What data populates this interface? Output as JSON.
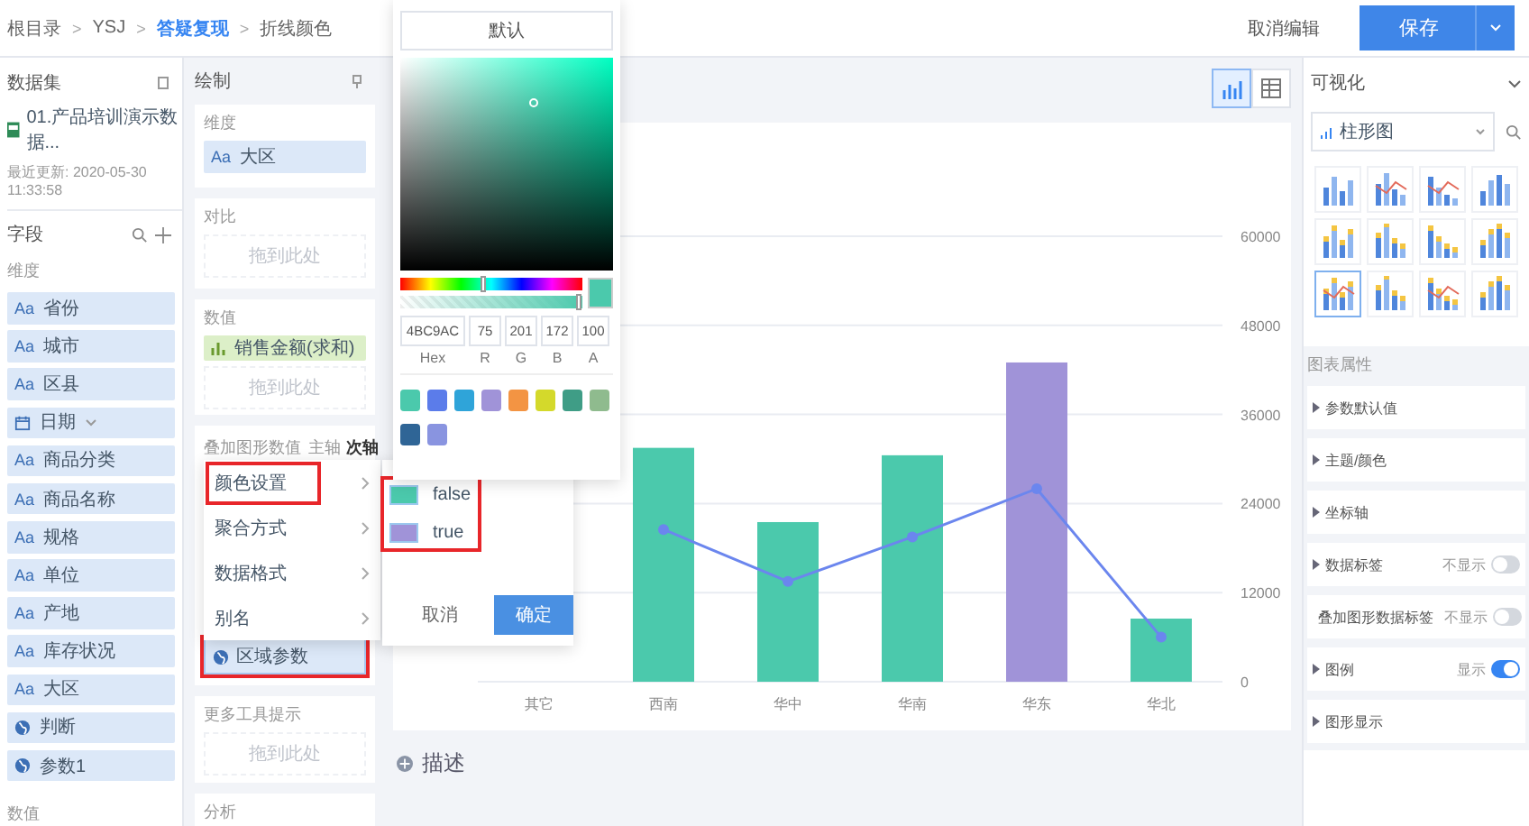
{
  "top_bar": {
    "breadcrumb": [
      {
        "label": "根目录",
        "link": false
      },
      {
        "label": "YSJ",
        "link": false
      },
      {
        "label": "答疑复现",
        "link": true
      },
      {
        "label": "折线颜色",
        "link": false
      }
    ],
    "separator": ">",
    "cancel": "取消编辑",
    "save": "保存"
  },
  "dataset_panel": {
    "title": "数据集",
    "dataset": "01.产品培训演示数据...",
    "updated": "最近更新: 2020-05-30 11:33:58",
    "fields_title": "字段",
    "dimension_label": "维度",
    "fields": [
      {
        "kind": "text",
        "prefix": "Aa",
        "label": "省份"
      },
      {
        "kind": "text",
        "prefix": "Aa",
        "label": "城市"
      },
      {
        "kind": "text",
        "prefix": "Aa",
        "label": "区县"
      },
      {
        "kind": "date",
        "label": "日期"
      },
      {
        "kind": "text",
        "prefix": "Aa",
        "label": "商品分类"
      },
      {
        "kind": "text",
        "prefix": "Aa",
        "label": "商品名称"
      },
      {
        "kind": "text",
        "prefix": "Aa",
        "label": "规格"
      },
      {
        "kind": "text",
        "prefix": "Aa",
        "label": "单位"
      },
      {
        "kind": "text",
        "prefix": "Aa",
        "label": "产地"
      },
      {
        "kind": "text",
        "prefix": "Aa",
        "label": "库存状况"
      },
      {
        "kind": "text",
        "prefix": "Aa",
        "label": "大区"
      },
      {
        "kind": "param",
        "label": "判断"
      },
      {
        "kind": "param",
        "label": "参数1"
      }
    ],
    "measure_label": "数值"
  },
  "draw_panel": {
    "title": "绘制",
    "dimension": {
      "label": "维度",
      "item_prefix": "Aa",
      "item": "大区"
    },
    "compare": {
      "label": "对比",
      "placeholder": "拖到此处"
    },
    "value": {
      "label": "数值",
      "item": "销售金额(求和)",
      "placeholder": "拖到此处"
    },
    "overlay": {
      "label": "叠加图形数值",
      "axes": [
        {
          "label": "主轴",
          "selected": false
        },
        {
          "label": "次轴",
          "selected": true
        }
      ]
    },
    "region_param": {
      "label": "区域参数",
      "highlighted": true
    },
    "tooltip": {
      "label": "更多工具提示",
      "placeholder": "拖到此处"
    },
    "analysis": {
      "label": "分析"
    }
  },
  "context_menu": [
    {
      "label": "颜色设置",
      "highlighted": true
    },
    {
      "label": "聚合方式",
      "highlighted": false
    },
    {
      "label": "数据格式",
      "highlighted": false
    },
    {
      "label": "别名",
      "highlighted": false
    }
  ],
  "color_picker": {
    "default_button": "默认",
    "hue": {
      "level": 0.46
    },
    "alpha": {
      "level": 1
    },
    "hex": "4BC9AC",
    "r": "75",
    "g": "201",
    "b": "172",
    "a": "100",
    "labels": [
      "Hex",
      "R",
      "G",
      "B",
      "A"
    ],
    "swatches": [
      {
        "color": "#4bc9ac"
      },
      {
        "color": "#5b7cea"
      },
      {
        "color": "#2fa4d9"
      },
      {
        "color": "#a093d8"
      },
      {
        "color": "#f39443"
      },
      {
        "color": "#d4d92b"
      },
      {
        "color": "#3f9d86"
      },
      {
        "color": "#8fbb8e"
      },
      {
        "color": "#2f6596"
      },
      {
        "color": "#8994e0"
      }
    ]
  },
  "legend_popup": {
    "highlighted": true,
    "items": [
      {
        "label": "false",
        "color": "#4bc9ac"
      },
      {
        "label": "true",
        "color": "#a093d8"
      }
    ],
    "cancel": "取消",
    "confirm": "确定"
  },
  "view_toggle": [
    {
      "kind": "chart",
      "selected": true
    },
    {
      "kind": "table",
      "selected": false
    }
  ],
  "chart": {
    "chart_data": {
      "type": "bar",
      "stacked": true,
      "grid": true,
      "categories": [
        "其它",
        "西南",
        "华中",
        "华南",
        "华东",
        "华北"
      ],
      "series": [
        {
          "color": "#4bc9ac",
          "values": [
            null,
            31500,
            21500,
            30500,
            null,
            8500
          ]
        },
        {
          "color": "#a093d8",
          "values": [
            null,
            null,
            null,
            null,
            43000,
            null
          ]
        }
      ],
      "ylim": [
        0,
        60000
      ],
      "yticks": [
        0,
        12000,
        24000,
        36000,
        48000,
        60000
      ]
    },
    "overlay": {
      "chart_data": {
        "type": "line",
        "series": [
          {
            "color": "#6b86ee",
            "marker": true,
            "values": [
              null,
              20500,
              13500,
              19500,
              26000,
              6000
            ]
          }
        ],
        "ylim": [
          0,
          60000
        ]
      }
    }
  },
  "description": {
    "label": "描述"
  },
  "visual_panel": {
    "title": "可视化",
    "chart_type": "柱形图",
    "chart_types": [
      {
        "selected": false
      },
      {
        "selected": false
      },
      {
        "selected": false
      },
      {
        "selected": false
      },
      {
        "selected": false
      },
      {
        "selected": false
      },
      {
        "selected": false
      },
      {
        "selected": false
      },
      {
        "selected": true
      },
      {
        "selected": false
      },
      {
        "selected": false
      },
      {
        "selected": false
      }
    ],
    "properties_title": "图表属性",
    "properties": [
      {
        "label": "参数默认值"
      },
      {
        "label": "主题/颜色"
      },
      {
        "label": "坐标轴"
      },
      {
        "label": "数据标签",
        "status": "不显示",
        "on": false
      },
      {
        "label": "叠加图形数据标签",
        "status": "不显示",
        "on": false
      },
      {
        "label": "图例",
        "status": "显示",
        "on": true
      },
      {
        "label": "图形显示"
      }
    ]
  }
}
